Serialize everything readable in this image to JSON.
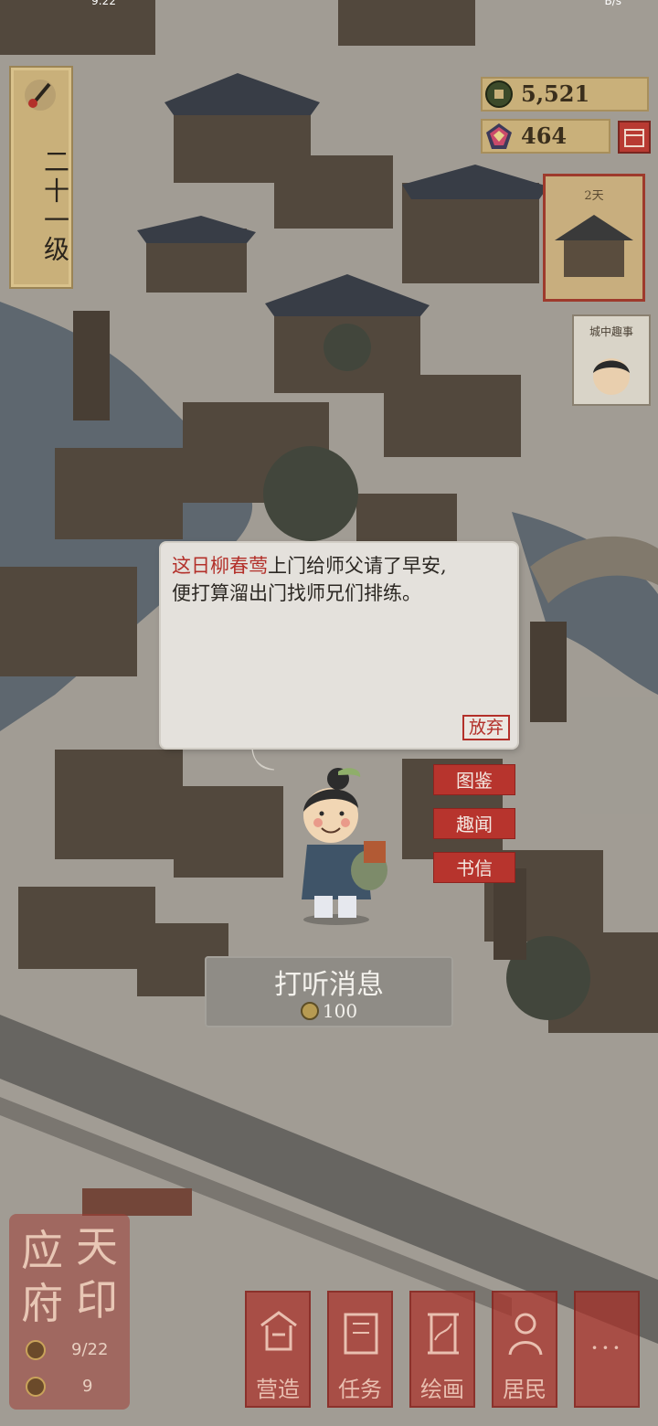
{
  "status_bar": {
    "left_text": "9:22",
    "right_text": "B/s"
  },
  "level": {
    "label": "二十一级",
    "icon": "brush-icon"
  },
  "currencies": [
    {
      "name": "copper-coin",
      "value": "5,521",
      "icon": "coin-icon"
    },
    {
      "name": "jade",
      "value": "464",
      "icon": "gem-icon"
    }
  ],
  "shop_icon": "shop-icon",
  "side_cards": {
    "season_label": "2天",
    "person_label": "城中趣事"
  },
  "dialog": {
    "name": "这日柳春莺",
    "line1_rest": "上门给师父请了早安,",
    "line2": "便打算溜出门找师兄们排练。",
    "abandon_label": "放弃"
  },
  "side_buttons": [
    {
      "label": "图鉴"
    },
    {
      "label": "趣闻"
    },
    {
      "label": "书信"
    }
  ],
  "inquire": {
    "title": "打听消息",
    "cost": "100"
  },
  "seal": {
    "chars": [
      "应",
      "天",
      "府",
      "印"
    ],
    "progress": "9/22",
    "count": "9"
  },
  "bottom_bar": [
    {
      "label": "营造",
      "icon": "build-icon"
    },
    {
      "label": "任务",
      "icon": "book-icon"
    },
    {
      "label": "绘画",
      "icon": "scroll-icon"
    },
    {
      "label": "居民",
      "icon": "resident-icon"
    },
    {
      "label": "···",
      "icon": "more-icon"
    }
  ],
  "colors": {
    "accent_red": "#b7342d",
    "gold": "#c9b07a",
    "dialog_bg": "#e4e1dc"
  }
}
